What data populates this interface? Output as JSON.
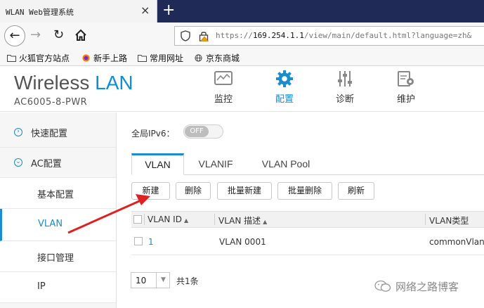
{
  "browser": {
    "tab_title": "WLAN Web管理系统",
    "tab_close": "×",
    "new_tab": "+",
    "back": "←",
    "forward": "→",
    "reload": "↻",
    "url_scheme": "https://",
    "url_host": "169.254.1.1",
    "url_path": "/view/main/default.html?language=zh&",
    "bookmarks": [
      {
        "label": "火狐官方站点",
        "icon": "folder-icon"
      },
      {
        "label": "新手上路",
        "icon": "firefox-icon"
      },
      {
        "label": "常用网址",
        "icon": "folder-icon"
      },
      {
        "label": "京东商城",
        "icon": "globe-icon"
      }
    ]
  },
  "header": {
    "brand_word1": "Wireless",
    "brand_word2": "LAN",
    "model": "AC6005-8-PWR",
    "menu": [
      {
        "label": "监控",
        "icon": "monitor-icon",
        "active": false
      },
      {
        "label": "配置",
        "icon": "gear-icon",
        "active": true
      },
      {
        "label": "诊断",
        "icon": "sliders-icon",
        "active": false
      },
      {
        "label": "维护",
        "icon": "maintenance-icon",
        "active": false
      }
    ]
  },
  "sidebar": {
    "items": [
      {
        "label": "快速配置",
        "icon": "chevron-right-circle-icon"
      },
      {
        "label": "AC配置",
        "icon": "chevron-down-circle-icon"
      },
      {
        "label": "基本配置"
      },
      {
        "label": "VLAN",
        "active": true
      },
      {
        "label": "接口管理"
      },
      {
        "label": "IP"
      }
    ]
  },
  "main": {
    "ipv6_label": "全局IPv6：",
    "ipv6_toggle": "OFF",
    "tabs": [
      "VLAN",
      "VLANIF",
      "VLAN Pool"
    ],
    "buttons": [
      "新建",
      "删除",
      "批量新建",
      "批量删除",
      "刷新"
    ],
    "table": {
      "columns": [
        "VLAN ID",
        "VLAN 描述",
        "VLAN类型"
      ],
      "sort_icon": "▲",
      "rows": [
        {
          "id": "1",
          "desc": "VLAN 0001",
          "type": "commonVlan"
        }
      ]
    },
    "pager": {
      "page_size": "10",
      "arrow": "▼",
      "total": "共1条"
    }
  },
  "watermark": "网络之路博客",
  "colors": {
    "accent": "#1a8ccf",
    "tabbar": "#1f2a57",
    "annotation_arrow": "#e02020"
  }
}
